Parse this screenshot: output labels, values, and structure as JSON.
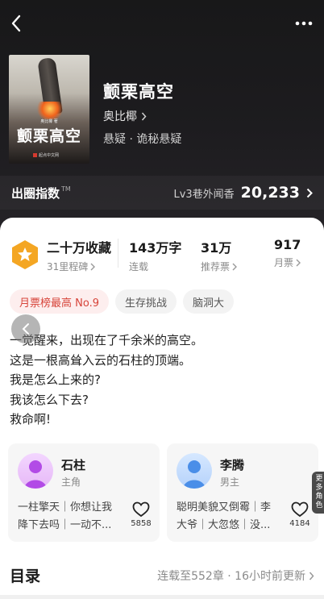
{
  "header": {
    "cover": {
      "title": "颤栗高空",
      "author_small": "奥比椰 著",
      "publisher": "起点中文网"
    },
    "book_title": "颤栗高空",
    "author": "奥比椰",
    "genre": "悬疑 · 诡秘悬疑",
    "circle": {
      "label": "出圈指数",
      "tm": "TM",
      "level": "Lv3巷外闻香",
      "value": "20,233"
    }
  },
  "stats": [
    {
      "big": "二十万收藏",
      "small": "31里程碑"
    },
    {
      "big": "143万字",
      "small": "连载"
    },
    {
      "big": "31万",
      "small": "推荐票"
    },
    {
      "big": "917",
      "small": "月票"
    }
  ],
  "tags": [
    "月票榜最高 No.9",
    "生存挑战",
    "脑洞大"
  ],
  "intro": [
    "一觉醒来，出现在了千余米的高空。",
    "这是一根高耸入云的石柱的顶端。",
    "我是怎么上来的?",
    "我该怎么下去?",
    "救命啊!"
  ],
  "characters": [
    {
      "name": "石柱",
      "role": "主角",
      "desc": [
        "一柱擎天｜你想让我",
        "降下去吗｜一动不..."
      ],
      "likes": "5858",
      "color": "#b24be6"
    },
    {
      "name": "李腾",
      "role": "男主",
      "desc": [
        "聪明美貌又倒霉｜李",
        "大爷｜大忽悠｜没..."
      ],
      "likes": "4184",
      "color": "#4a8ee8"
    }
  ],
  "more_roles": [
    "更",
    "多",
    "角",
    "色"
  ],
  "toc": {
    "title": "目录",
    "status": "连载至552章 · 16小时前更新"
  },
  "colors": {
    "accent": "#d7443a",
    "badge": "#f4a623"
  }
}
